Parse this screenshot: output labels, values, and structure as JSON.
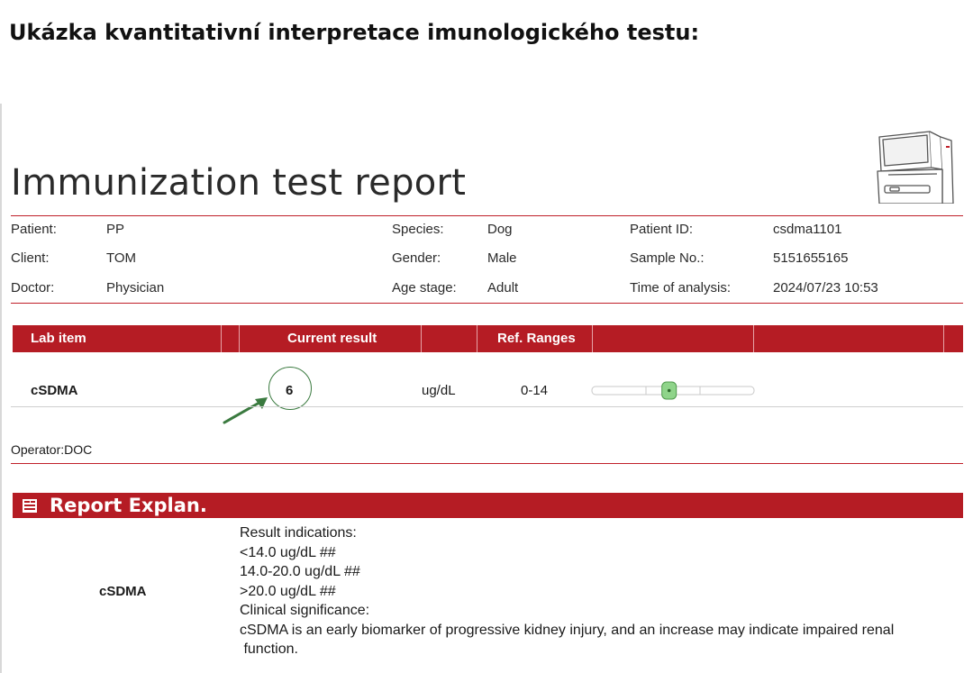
{
  "heading": "Ukázka kvantitativní interpretace imunologického testu:",
  "report": {
    "title": "Immunization test report",
    "patient_info": [
      {
        "label": "Patient:",
        "value": "PP"
      },
      {
        "label": "Client:",
        "value": "TOM"
      },
      {
        "label": "Doctor:",
        "value": "Physician"
      },
      {
        "label": "Species:",
        "value": "Dog"
      },
      {
        "label": "Gender:",
        "value": "Male"
      },
      {
        "label": "Age stage:",
        "value": "Adult"
      },
      {
        "label": "Patient ID:",
        "value": "csdma1101"
      },
      {
        "label": "Sample No.:",
        "value": "5151655165"
      },
      {
        "label": "Time of analysis:",
        "value": "2024/07/23 10:53"
      }
    ],
    "table": {
      "headers": [
        "Lab item",
        "Current result",
        "Ref. Ranges"
      ],
      "row": {
        "item": "cSDMA",
        "result": "6",
        "unit": "ug/dL",
        "range": "0-14",
        "gauge_value": 6,
        "gauge_range": [
          0,
          14
        ]
      }
    },
    "operator": "Operator:DOC",
    "explan": {
      "title": "Report Explan.",
      "item": "cSDMA",
      "lines": [
        "Result indications:",
        "<14.0 ug/dL ##",
        "14.0-20.0 ug/dL ##",
        ">20.0 ug/dL ##",
        "Clinical significance:",
        "cSDMA is an early biomarker of progressive kidney injury, and an increase may indicate impaired renal",
        " function."
      ]
    }
  },
  "colors": {
    "report_red": "#b51c24",
    "gauge_marker": "#8fd48a",
    "arrow_green": "#3a7a3f"
  }
}
